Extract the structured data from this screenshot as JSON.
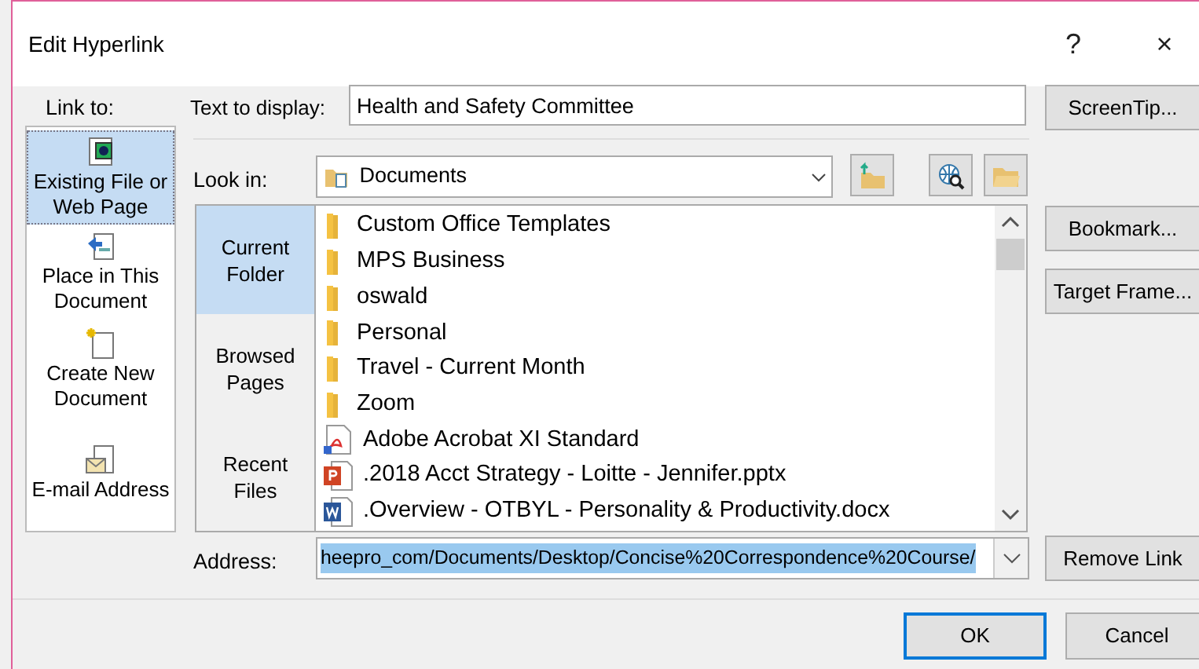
{
  "window": {
    "title": "Edit Hyperlink",
    "help": "?",
    "close": "×"
  },
  "link_to": {
    "label": "Link to:",
    "items": [
      {
        "label": "Existing File or Web Page",
        "kind": "file",
        "selected": true
      },
      {
        "label": "Place in This Document",
        "kind": "place",
        "selected": false
      },
      {
        "label": "Create New Document",
        "kind": "new",
        "selected": false
      },
      {
        "label": "E-mail Address",
        "kind": "email",
        "selected": false
      }
    ]
  },
  "text_to_display": {
    "label": "Text to display:",
    "value": "Health and Safety Committee"
  },
  "look_in": {
    "label": "Look in:",
    "value": "Documents"
  },
  "nav": [
    {
      "label": "Current Folder",
      "selected": true
    },
    {
      "label": "Browsed Pages",
      "selected": false
    },
    {
      "label": "Recent Files",
      "selected": false
    }
  ],
  "files": [
    {
      "name": "Custom Office Templates",
      "kind": "folder"
    },
    {
      "name": "MPS Business",
      "kind": "folder"
    },
    {
      "name": "oswald",
      "kind": "folder"
    },
    {
      "name": "Personal",
      "kind": "folder"
    },
    {
      "name": "Travel - Current Month",
      "kind": "folder"
    },
    {
      "name": "Zoom",
      "kind": "folder"
    },
    {
      "name": "Adobe Acrobat XI Standard",
      "kind": "pdf"
    },
    {
      "name": ".2018 Acct Strategy - Loitte - Jennifer.pptx",
      "kind": "pptx"
    },
    {
      "name": ".Overview - OTBYL - Personality & Productivity.docx",
      "kind": "docx"
    }
  ],
  "address": {
    "label": "Address:",
    "value": "heepro_com/Documents/Desktop/Concise%20Correspondence%20Course/",
    "highlighted": true
  },
  "side_buttons": [
    {
      "label": "ScreenTip..."
    },
    {
      "label": "Bookmark..."
    },
    {
      "label": "Target Frame..."
    },
    {
      "label": "Remove Link"
    }
  ],
  "footer_buttons": [
    {
      "label": "OK",
      "default": true
    },
    {
      "label": "Cancel",
      "default": false
    }
  ]
}
